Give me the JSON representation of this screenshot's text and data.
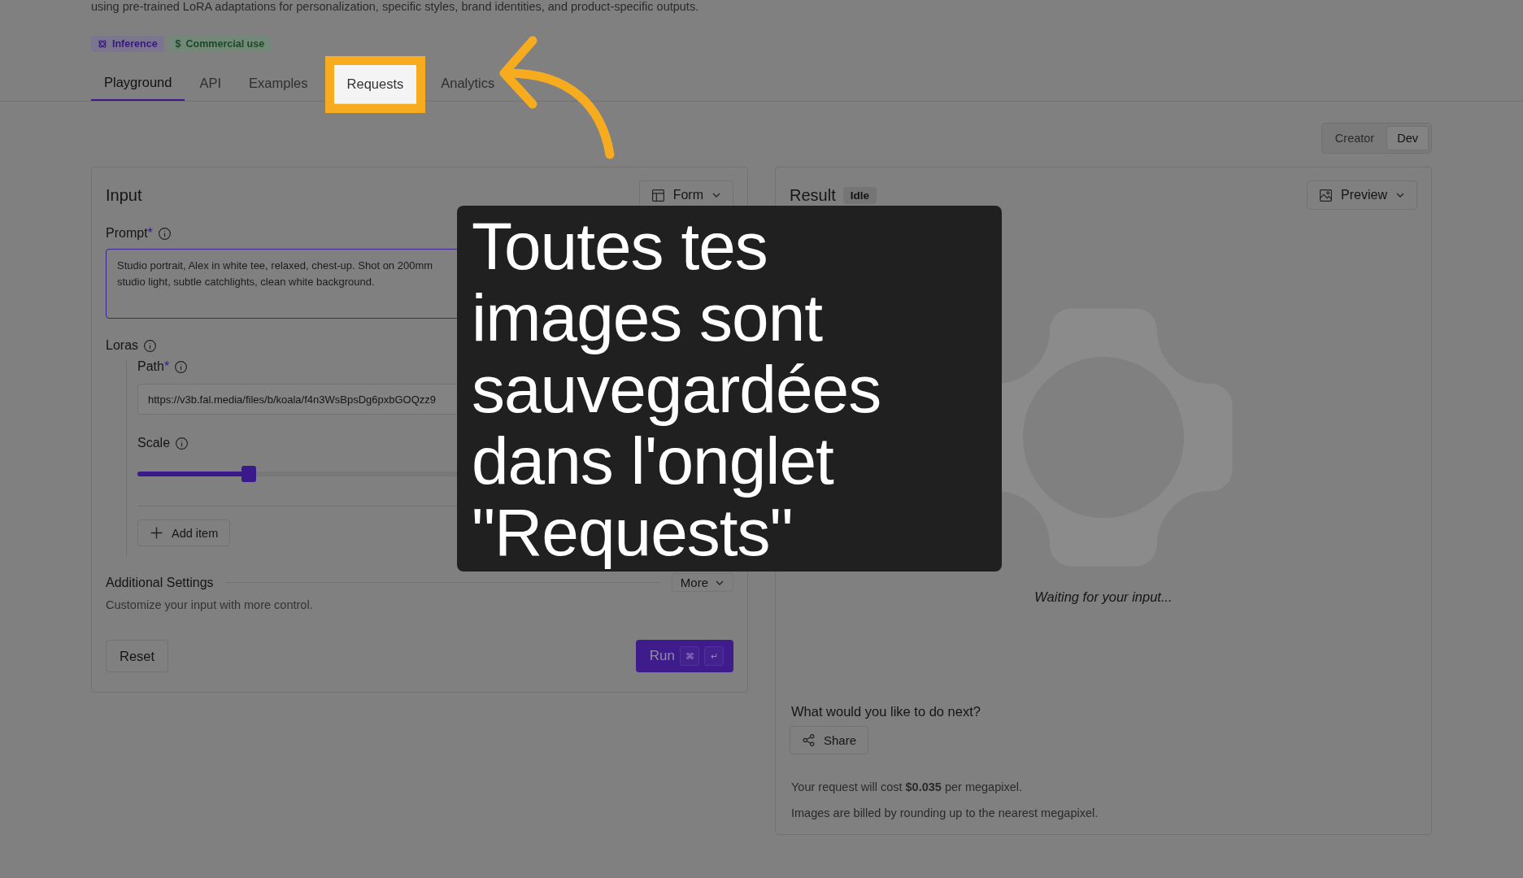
{
  "description": "using pre-trained LoRA adaptations for personalization, specific styles, brand identities, and product-specific outputs.",
  "badges": [
    {
      "kind": "inference",
      "label": "Inference"
    },
    {
      "kind": "commercial",
      "icon": "$",
      "label": "Commercial use"
    }
  ],
  "tabs": [
    {
      "label": "Playground",
      "selected": true,
      "highlighted": false
    },
    {
      "label": "API",
      "selected": false,
      "highlighted": false
    },
    {
      "label": "Examples",
      "selected": false,
      "highlighted": false
    },
    {
      "label": "Requests",
      "selected": false,
      "highlighted": true
    },
    {
      "label": "Analytics",
      "selected": false,
      "highlighted": false
    }
  ],
  "mode_toggle": [
    {
      "label": "Creator",
      "selected": false
    },
    {
      "label": "Dev",
      "selected": true
    }
  ],
  "input_panel": {
    "title": "Input",
    "view_button": "Form",
    "prompt": {
      "label": "Prompt",
      "required_mark": "*",
      "value": "Studio portrait, Alex in white tee, relaxed, chest-up. Shot on 200mm\nstudio light, subtle catchlights, clean white background."
    },
    "loras": {
      "label": "Loras",
      "path": {
        "label": "Path",
        "required_mark": "*",
        "value": "https://v3b.fal.media/files/b/koala/f4n3WsBpsDg6pxbGOQzz9"
      },
      "scale": {
        "label": "Scale",
        "level": 0.21
      },
      "add_button": "Add item"
    },
    "additional": {
      "title": "Additional Settings",
      "subtitle": "Customize your input with more control.",
      "more_button": "More"
    },
    "reset_button": "Reset",
    "run_button": {
      "label": "Run",
      "keys": [
        "⌘",
        "↵"
      ]
    }
  },
  "result_panel": {
    "title": "Result",
    "status": "Idle",
    "view_button": "Preview",
    "waiting": "Waiting for your input...",
    "next_title": "What would you like to do next?",
    "share_button": "Share",
    "cost": "Your request will cost **$0.035** per megapixel.",
    "billing": "Images are billed by rounding up to the nearest megapixel."
  },
  "callout": {
    "text": "Toutes tes images sont sauvegardées dans l'onglet \"Requests\""
  }
}
